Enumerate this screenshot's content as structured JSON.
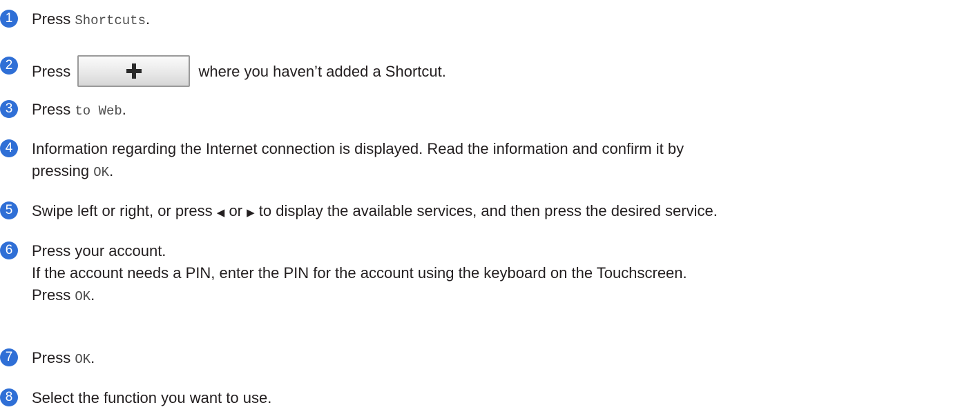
{
  "steps": [
    {
      "number": "1",
      "prefix": "Press ",
      "code": "Shortcuts",
      "suffix": "."
    },
    {
      "number": "2",
      "prefix": "Press",
      "button_icon": "plus-icon",
      "suffix": "where you haven’t added a Shortcut."
    },
    {
      "number": "3",
      "prefix": "Press ",
      "code": "to Web",
      "suffix": "."
    },
    {
      "number": "4",
      "line1": "Information regarding the Internet connection is displayed. Read the information and confirm it by",
      "line2_prefix": "pressing ",
      "line2_code": "OK",
      "line2_suffix": "."
    },
    {
      "number": "5",
      "text_a": "Swipe left or right, or press ",
      "arrow_left": "◀",
      "text_b": " or ",
      "arrow_right": "▶",
      "text_c": " to display the available services, and then press the desired service."
    },
    {
      "number": "6",
      "line1": "Press your account.",
      "line2": "If the account needs a PIN, enter the PIN for the account using the keyboard on the Touchscreen.",
      "line3_prefix": "Press ",
      "line3_code": "OK",
      "line3_suffix": "."
    },
    {
      "number": "7",
      "prefix": "Press ",
      "code": "OK",
      "suffix": "."
    },
    {
      "number": "8",
      "text": "Select the function you want to use."
    }
  ],
  "colors": {
    "badge": "#2f6fd6",
    "text": "#231f20",
    "code": "#4d4d4d"
  }
}
